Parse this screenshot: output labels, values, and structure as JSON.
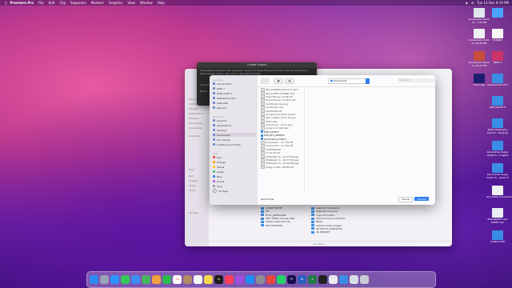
{
  "menubar": {
    "apple": "",
    "app": "Premiere Pro",
    "items": [
      "File",
      "Edit",
      "Clip",
      "Sequence",
      "Markers",
      "Graphics",
      "View",
      "Window",
      "Help"
    ],
    "clock": "Tue 13 Dec 6:19 PM"
  },
  "desktop_icons": [
    {
      "label": "Screenshot 2022-12...1.32 PM",
      "color": "#dfe6ee"
    },
    {
      "label": "",
      "color": "#4aa3ff"
    },
    {
      "label": "Screenshot 2022-0...06.28 PM",
      "color": "#eef0f3"
    },
    {
      "label": "PUNJAB",
      "color": "#f7f7f7"
    },
    {
      "label": "Screenshot 2022-0...26.24 PM",
      "color": "#c94c3c"
    },
    {
      "label": "NEW 9",
      "color": "#cc3366"
    },
    {
      "label": "Track.aep",
      "color": "#1e1e6e"
    },
    {
      "label": "RGB SAUCE 1P 8",
      "color": "#3a8ee6"
    },
    {
      "label": "RGB SAUCE 8",
      "color": "#3a8ee6"
    },
    {
      "label": "RGB Calligraphy Font (P... Kerging)",
      "color": "#3a8ee6"
    },
    {
      "label": "Decorative happy diwali fo...3 agaiw",
      "color": "#3a8ee6"
    },
    {
      "label": "Decorative happy diwali fo...peesh fi",
      "color": "#3a8ee6"
    },
    {
      "label": "GUI_0968_Pricey.html",
      "color": "#f0f0f0"
    },
    {
      "label": "RGB BRIEFS LOG SHEET.xlsx",
      "color": "#e9eef4"
    },
    {
      "label": "SAMKA SHIP",
      "color": "#3a8ee6"
    }
  ],
  "create_dialog": {
    "title": "Create Project",
    "message": "This project was saved from a previous version of Adobe Premiere Pro and must be converted. It will be saved under a new name in Premiere Pro 2022.",
    "location_label": "Location",
    "name_label": "Name"
  },
  "finder": {
    "sidebar": [
      "Favourites",
      "AirDrop",
      "Recents",
      "Applications",
      "Desktop",
      "Documents",
      "Downloads",
      "Locations",
      "Tags",
      "Red",
      "Orange",
      "Yellow",
      "Green",
      "All Tags..."
    ],
    "folders": [
      "LANGE WHITE",
      "ICF",
      "RTUL_JEWELLERS",
      "SHIV PRINT_deluge_FiRe",
      "Master Class Erik Ge",
      "DGT EXPORTS"
    ],
    "right_items": [
      "aligment meaoping",
      "aligment ring.png",
      "Logo Animation",
      "Derived scene collection",
      "BKGS",
      "Aligner Sheet images",
      "3D MATTS (VARIANTS)",
      "4K PROJECT"
    ],
    "footer": "22 items"
  },
  "dialog": {
    "sidebar_sections": {
      "locations": "Locations",
      "favourites": "Favourites",
      "tags": "Tags"
    },
    "locations": [
      "iCloud Drive",
      "RGB !!",
      "RGB LACIE 3",
      "RGB BACK UP 8",
      "PURLASE",
      "Network"
    ],
    "favourites": [
      "Recents",
      "Applications",
      "Desktop",
      "Downloads",
      "Documents",
      "Creative Cloud Files"
    ],
    "tags": [
      {
        "label": "Red",
        "color": "#ff3b30"
      },
      {
        "label": "Orange",
        "color": "#ff9500"
      },
      {
        "label": "Yellow",
        "color": "#ffcc00"
      },
      {
        "label": "Green",
        "color": "#34c759"
      },
      {
        "label": "Blue",
        "color": "#007aff"
      },
      {
        "label": "Purple",
        "color": "#af52de"
      },
      {
        "label": "Grey",
        "color": "#8e8e93"
      },
      {
        "label": "All Tags...",
        "color": ""
      }
    ],
    "location": "Downloads",
    "search_placeholder": "Search",
    "files": [
      {
        "name": "IMG_SOAMKR_Winner R.mp4",
        "folder": false
      },
      {
        "name": "SRL_R_BEST_ROUND.mp4",
        "folder": false
      },
      {
        "name": "Heart Manual_12.08.pdf",
        "folder": false
      },
      {
        "name": "Heart Manual_13.0951.pdf",
        "folder": false
      },
      {
        "name": "Certificate copy.png",
        "folder": false
      },
      {
        "name": "Certificate copy",
        "folder": false
      },
      {
        "name": "Certificate.pdf",
        "folder": false
      },
      {
        "name": "pcf_gkmss-0_04-02-03.pdf",
        "folder": false
      },
      {
        "name": "light rotated_13.21.10.png",
        "folder": false
      },
      {
        "name": "LPCD copy",
        "folder": false
      },
      {
        "name": "Lumetri pro...10.11.png",
        "folder": false
      },
      {
        "name": "gurgaon 2.mp4-tape",
        "folder": false
      },
      {
        "name": "RGB CLIENTS",
        "folder": true
      },
      {
        "name": "HPR_BTS_ORDERS",
        "folder": true
      },
      {
        "name": "Santa Neil ke Father",
        "folder": true
      },
      {
        "name": "Screenshot ...at 7.39 PM",
        "folder": false
      },
      {
        "name": "Screenshot ...at 7.40 PM",
        "folder": false
      },
      {
        "name": "STORYBOARD",
        "folder": false
      },
      {
        "name": "17.10 PC.pdf",
        "folder": false
      },
      {
        "name": "WhatsApp Im...10.57 PM.jpeg",
        "folder": false
      },
      {
        "name": "WhatsApp Im...10.57 PM.jpeg",
        "folder": false
      },
      {
        "name": "WhatsApp Im...10.58 PM.jpeg",
        "folder": false
      },
      {
        "name": "Image to PDF...89 PM.pdf",
        "folder": false
      }
    ],
    "new_folder": "New Folder",
    "cancel": "Cancel",
    "choose": "Choose"
  },
  "dock": [
    {
      "name": "finder",
      "color": "#2a8cf0"
    },
    {
      "name": "launchpad",
      "color": "#9aa3b3"
    },
    {
      "name": "safari",
      "color": "#2b95ff"
    },
    {
      "name": "messages",
      "color": "#34c759"
    },
    {
      "name": "mail",
      "color": "#3d8ef0"
    },
    {
      "name": "maps",
      "color": "#48b560"
    },
    {
      "name": "photos",
      "color": "#f0a03c"
    },
    {
      "name": "facetime",
      "color": "#2dbb4f"
    },
    {
      "name": "calendar",
      "color": "#ffffff"
    },
    {
      "name": "contacts",
      "color": "#b08b63"
    },
    {
      "name": "reminders",
      "color": "#f5f5f5"
    },
    {
      "name": "notes",
      "color": "#f7d74a"
    },
    {
      "name": "tv",
      "color": "#1c1c1c"
    },
    {
      "name": "music",
      "color": "#fa3e59"
    },
    {
      "name": "podcasts",
      "color": "#a04ddf"
    },
    {
      "name": "appstore",
      "color": "#1d8cf5"
    },
    {
      "name": "settings",
      "color": "#8e8e93"
    },
    {
      "name": "chrome",
      "color": "#e8463a"
    },
    {
      "name": "whatsapp",
      "color": "#25d366"
    },
    {
      "name": "premiere",
      "color": "#1a0d4d"
    },
    {
      "name": "word",
      "color": "#2b5ebf"
    },
    {
      "name": "excel",
      "color": "#1f7a43"
    },
    {
      "name": "terminal",
      "color": "#222222"
    },
    {
      "name": "preview",
      "color": "#e9e9ef"
    },
    {
      "name": "folder",
      "color": "#3a8ee6"
    },
    {
      "name": "folder2",
      "color": "#d9dde6"
    },
    {
      "name": "trash",
      "color": "#c7ccd4"
    }
  ],
  "dock_labels": {
    "calendar": "13",
    "premiere": "Pr",
    "word": "W",
    "excel": "X",
    "tv": "tv"
  }
}
